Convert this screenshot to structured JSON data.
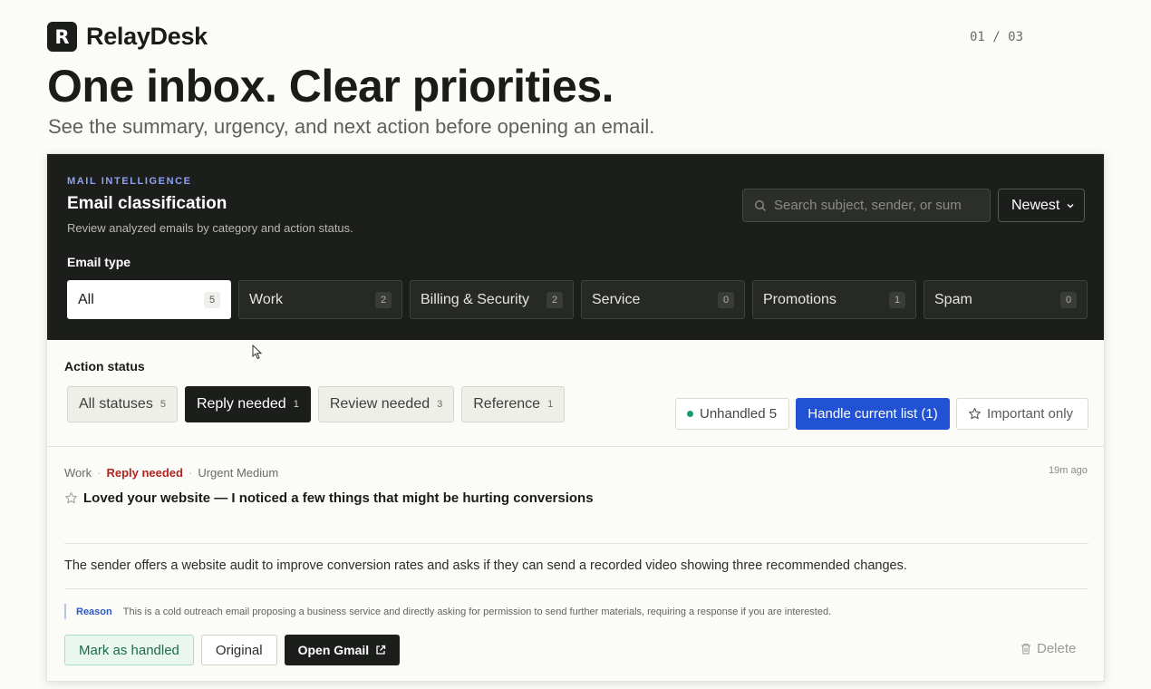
{
  "brand": {
    "logo_letter": "R",
    "name": "RelayDesk"
  },
  "pager": "01 / 03",
  "hero": {
    "title": "One inbox. Clear priorities.",
    "subtitle": "See the summary, urgency, and next action before opening an email."
  },
  "panel": {
    "eyebrow": "MAIL INTELLIGENCE",
    "title": "Email classification",
    "description": "Review analyzed emails by category and action status.",
    "search_placeholder": "Search subject, sender, or sum",
    "sort_value": "Newest",
    "email_type_label": "Email type",
    "email_types": [
      {
        "label": "All",
        "count": "5"
      },
      {
        "label": "Work",
        "count": "2"
      },
      {
        "label": "Billing & Security",
        "count": "2"
      },
      {
        "label": "Service",
        "count": "0"
      },
      {
        "label": "Promotions",
        "count": "1"
      },
      {
        "label": "Spam",
        "count": "0"
      }
    ]
  },
  "status": {
    "label": "Action status",
    "filters": [
      {
        "label": "All statuses",
        "count": "5"
      },
      {
        "label": "Reply needed",
        "count": "1"
      },
      {
        "label": "Review needed",
        "count": "3"
      },
      {
        "label": "Reference",
        "count": "1"
      }
    ],
    "unhandled_label": "Unhandled 5",
    "handle_button": "Handle current list (1)",
    "important_button": "Important only"
  },
  "email": {
    "category": "Work",
    "status": "Reply needed",
    "urgency": "Urgent Medium",
    "time": "19m ago",
    "subject": "Loved your website — I noticed a few things that might be hurting conversions",
    "summary": "The sender offers a website audit to improve conversion rates and asks if they can send a recorded video showing three recommended changes.",
    "reason_label": "Reason",
    "reason_text": "This is a cold outreach email proposing a business service and directly asking for permission to send further materials, requiring a response if you are interested.",
    "mark_handled": "Mark as handled",
    "original": "Original",
    "open_gmail": "Open Gmail",
    "delete": "Delete"
  },
  "colors": {
    "accent_blue": "#2152d4",
    "dark_panel": "#1c1e1c",
    "reply_red": "#b42323",
    "handled_green": "#1c9a68"
  }
}
